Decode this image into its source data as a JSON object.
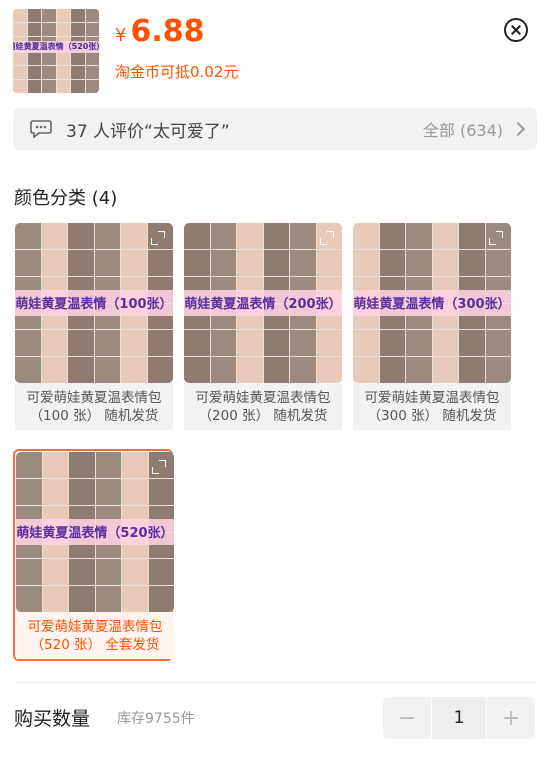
{
  "header": {
    "price_currency": "¥",
    "price_value": "6.88",
    "coin_discount": "淘金币可抵0.02元",
    "thumb_banner": "萌娃黄夏温表情（520张）"
  },
  "reviews": {
    "summary": "37 人评价“太可爱了”",
    "all_label": "全部 (634)"
  },
  "section": {
    "title": "颜色分类 (4)"
  },
  "variants": [
    {
      "banner": "萌娃黄夏温表情（100张）",
      "line1": "可爱萌娃黄夏温表情包",
      "line2": "（100 张） 随机发货",
      "selected": false
    },
    {
      "banner": "萌娃黄夏温表情（200张）",
      "line1": "可爱萌娃黄夏温表情包",
      "line2": "（200 张） 随机发货",
      "selected": false
    },
    {
      "banner": "萌娃黄夏温表情（300张）",
      "line1": "可爱萌娃黄夏温表情包",
      "line2": "（300 张） 随机发货",
      "selected": false
    },
    {
      "banner": "萌娃黄夏温表情（520张）",
      "line1": "可爱萌娃黄夏温表情包",
      "line2": "（520 张） 全套发货",
      "selected": true
    }
  ],
  "quantity": {
    "title": "购买数量",
    "stock": "库存9755件",
    "value": "1",
    "minus": "−",
    "plus": "+"
  },
  "colors": {
    "accent": "#ff5000",
    "selected_border": "#ff6a3d",
    "banner_bg": "#ffd2e1",
    "banner_text": "#5a2da0"
  },
  "icons": {
    "close": "close-icon",
    "reviews": "chat-bubble-icon",
    "chevron": "chevron-right-icon",
    "expand": "expand-icon"
  }
}
